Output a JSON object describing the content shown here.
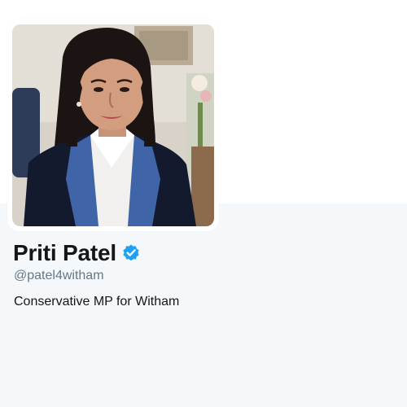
{
  "profile": {
    "display_name": "Priti Patel",
    "handle": "@patel4witham",
    "bio": "Conservative MP for Witham",
    "verified": true,
    "avatar_icon": "profile-photo"
  },
  "colors": {
    "background_top": "#ffffff",
    "background_profile": "#f5f8fa",
    "name": "#14171a",
    "handle": "#657786",
    "verified_badge": "#1da1f2"
  }
}
